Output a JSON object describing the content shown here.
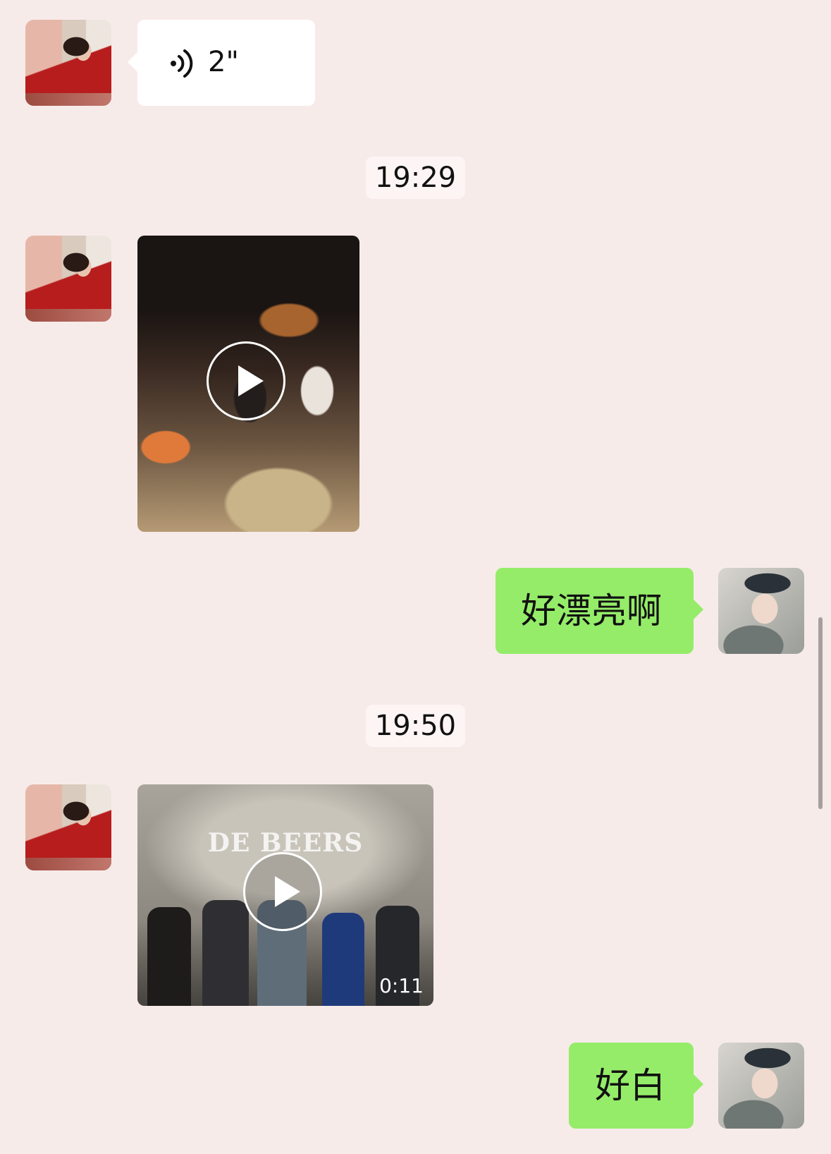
{
  "messages": {
    "voice": {
      "icon": "voice-wave-icon",
      "duration": "2\""
    },
    "timestamp_1": "19:29",
    "video_1": {
      "icon": "play-icon"
    },
    "reply_1": "好漂亮啊",
    "timestamp_2": "19:50",
    "video_2": {
      "icon": "play-icon",
      "brand_text": "DE BEERS",
      "duration": "0:11"
    },
    "reply_2": "好白"
  },
  "colors": {
    "background": "#f7ebea",
    "incoming_bubble": "#ffffff",
    "outgoing_bubble": "#95ec69",
    "timestamp_bg": "#fdf5f4"
  }
}
